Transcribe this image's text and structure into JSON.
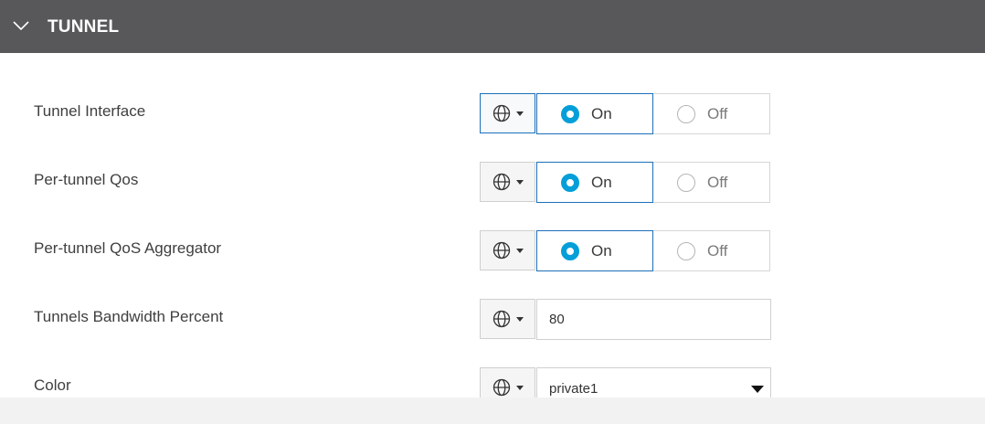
{
  "section": {
    "title": "TUNNEL"
  },
  "fields": [
    {
      "label": "Tunnel Interface",
      "on_label": "On",
      "off_label": "Off",
      "selected": "On"
    },
    {
      "label": "Per-tunnel Qos",
      "on_label": "On",
      "off_label": "Off",
      "selected": "On"
    },
    {
      "label": "Per-tunnel QoS Aggregator",
      "on_label": "On",
      "off_label": "Off",
      "selected": "On"
    },
    {
      "label": "Tunnels Bandwidth Percent",
      "value": "80"
    },
    {
      "label": "Color",
      "value": "private1"
    }
  ],
  "icons": {
    "scope": "globe-icon",
    "collapse": "chevron-down-icon",
    "dropdown": "caret-down-icon"
  },
  "colors": {
    "header_bg": "#58585a",
    "radio_checked": "#049fd9",
    "active_border": "#1d6fb8"
  }
}
